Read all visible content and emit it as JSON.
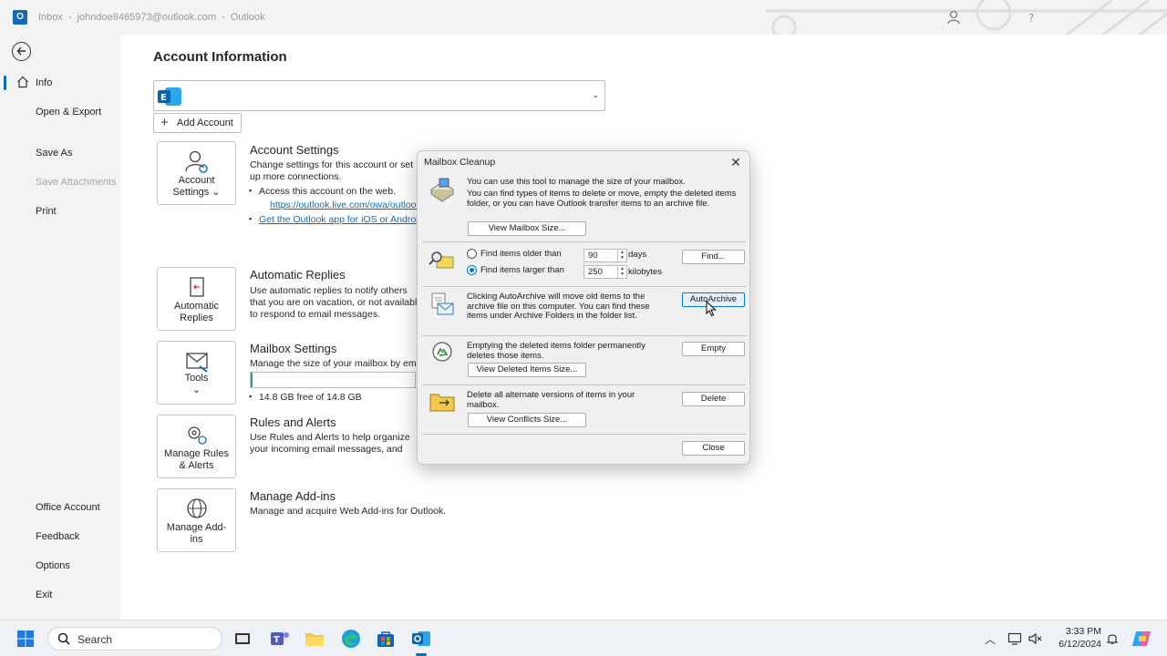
{
  "titlebar": {
    "app_icon_label": "O",
    "folder": "Inbox",
    "account": "johndoe8465973@outlook.com",
    "app": "Outlook",
    "separator": "-"
  },
  "sidebar": {
    "back_icon": "back-arrow-icon",
    "items": [
      {
        "label": "Info",
        "active": true
      },
      {
        "label": "Open & Export"
      },
      {
        "label": "Save As"
      },
      {
        "label": "Save Attachments",
        "disabled": true
      },
      {
        "label": "Print"
      },
      {
        "label": "Office Account"
      },
      {
        "label": "Feedback"
      },
      {
        "label": "Options"
      },
      {
        "label": "Exit"
      }
    ]
  },
  "main": {
    "title": "Account Information",
    "add_account": "Add Account",
    "sections": {
      "account_settings": {
        "tile_line1": "Account",
        "tile_line2": "Settings ⌄",
        "title": "Account Settings",
        "desc": "Change settings for this account or set up more connections.",
        "bullet1": "Access this account on the web.",
        "link1": "https://outlook.live.com/owa/outlook.com/",
        "link2": "Get the Outlook app for iOS or Android."
      },
      "automatic_replies": {
        "tile_line1": "Automatic",
        "tile_line2": "Replies",
        "title": "Automatic Replies",
        "desc": "Use automatic replies to notify others that you are on vacation, or not available to respond to email messages."
      },
      "mailbox_settings": {
        "tile_line1": "Tools",
        "tile_line2": "⌄",
        "title": "Mailbox Settings",
        "desc": "Manage the size of your mailbox by emptying Deleted Items and archiving.",
        "storage_text": "14.8 GB free of 14.8 GB",
        "storage_used_fraction": 0.01
      },
      "rules_alerts": {
        "tile_line1": "Manage Rules",
        "tile_line2": "& Alerts",
        "title": "Rules and Alerts",
        "desc": "Use Rules and Alerts to help organize your incoming email messages, and receive updates when items are added, changed, or removed."
      },
      "addins": {
        "tile_line1": "Manage Add-",
        "tile_line2": "ins",
        "title": "Manage Add-ins",
        "desc": "Manage and acquire Web Add-ins for Outlook."
      }
    }
  },
  "dialog": {
    "title": "Mailbox Cleanup",
    "intro_line1": "You can use this tool to manage the size of your mailbox.",
    "intro_line2": "You can find types of items to delete or move, empty the deleted items folder, or you can have Outlook transfer items to an archive file.",
    "view_mailbox_size": "View Mailbox Size...",
    "find_older_label": "Find items older than",
    "find_older_value": "90",
    "find_older_unit": "days",
    "find_larger_label": "Find items larger than",
    "find_larger_value": "250",
    "find_larger_unit": "kilobytes",
    "find_button": "Find...",
    "autoarchive_text": "Clicking AutoArchive will move old items to the archive file on this computer. You can find these items under Archive Folders in the folder list.",
    "autoarchive_button": "AutoArchive",
    "empty_text": "Emptying the deleted items folder permanently deletes those items.",
    "empty_button": "Empty",
    "view_deleted_size": "View Deleted Items Size...",
    "delete_text": "Delete all alternate versions of items in your mailbox.",
    "delete_button": "Delete",
    "view_conflicts_size": "View Conflicts Size...",
    "close_button": "Close"
  },
  "taskbar": {
    "search_text": "Search",
    "time": "3:33 PM",
    "date": "6/12/2024"
  }
}
